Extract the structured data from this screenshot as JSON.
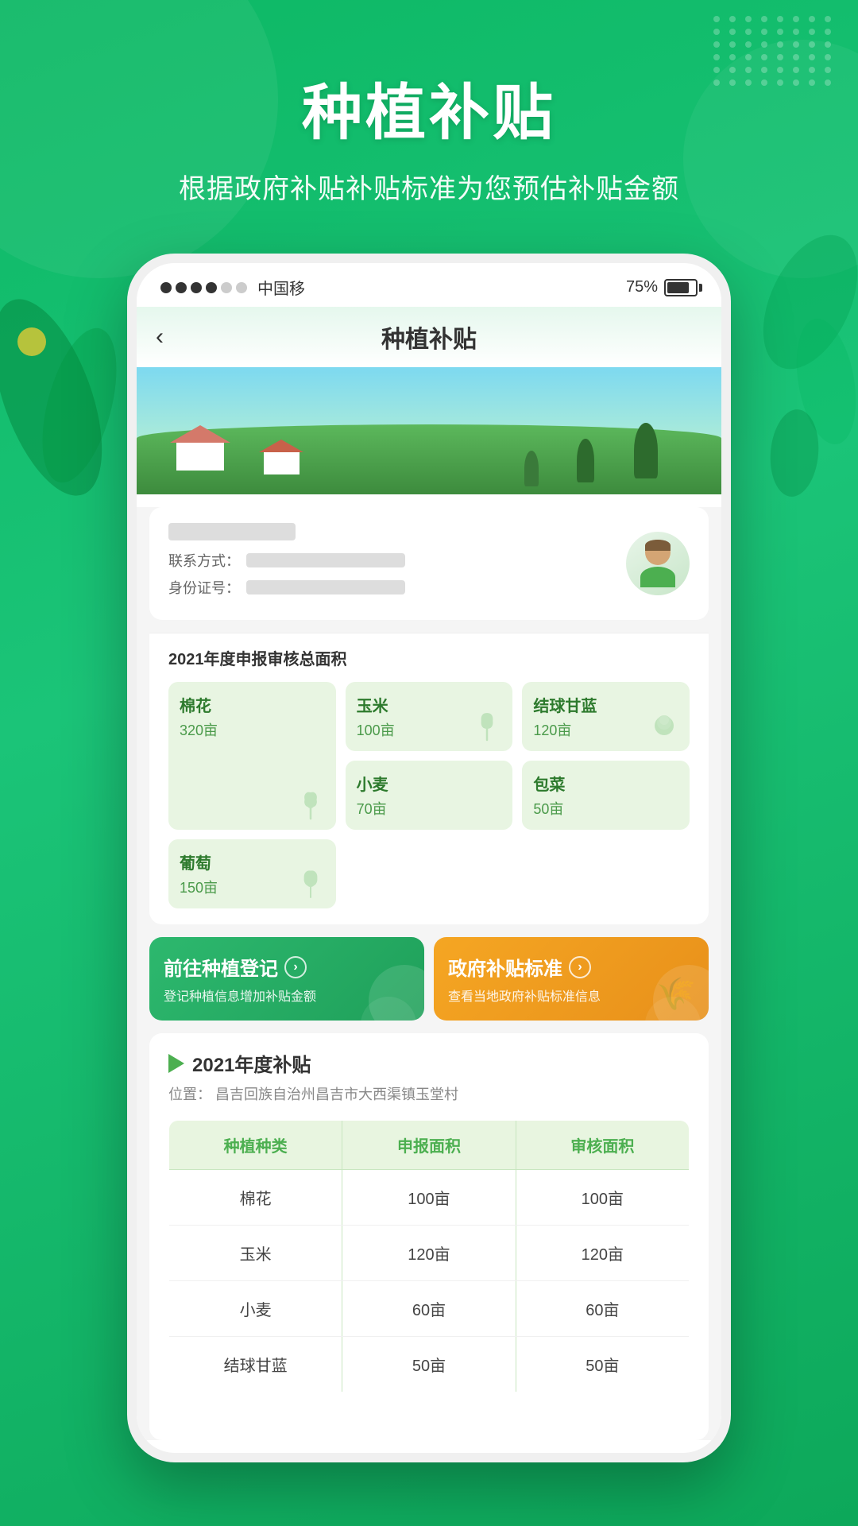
{
  "page": {
    "title": "种植补贴",
    "subtitle": "根据政府补贴补贴标准为您预估补贴金额"
  },
  "status_bar": {
    "carrier": "中国移",
    "battery_percent": "75%",
    "signals": [
      "filled",
      "filled",
      "filled",
      "filled",
      "empty",
      "empty"
    ]
  },
  "navbar": {
    "back_icon": "‹",
    "title": "种植补贴"
  },
  "user": {
    "contact_label": "联系方式：",
    "id_label": "身份证号："
  },
  "area_section": {
    "title": "2021年度申报审核总面积",
    "crops": [
      {
        "name": "棉花",
        "area": "320亩",
        "large": true
      },
      {
        "name": "玉米",
        "area": "100亩",
        "large": false
      },
      {
        "name": "结球甘蓝",
        "area": "120亩",
        "large": false
      },
      {
        "name": "小麦",
        "area": "70亩",
        "large": false
      },
      {
        "name": "包菜",
        "area": "50亩",
        "large": false
      },
      {
        "name": "葡萄",
        "area": "150亩",
        "large": false
      }
    ]
  },
  "action_buttons": [
    {
      "title": "前往种植登记",
      "description": "登记种植信息增加补贴金额",
      "style": "green"
    },
    {
      "title": "政府补贴标准",
      "description": "查看当地政府补贴标准信息",
      "style": "orange"
    }
  ],
  "subsidy_section": {
    "year_title": "2021年度补贴",
    "location_label": "位置：",
    "location": "昌吉回族自治州昌吉市大西渠镇玉堂村",
    "table": {
      "headers": [
        "种植种类",
        "申报面积",
        "审核面积"
      ],
      "rows": [
        {
          "crop": "棉花",
          "declared": "100亩",
          "reviewed": "100亩"
        },
        {
          "crop": "玉米",
          "declared": "120亩",
          "reviewed": "120亩"
        },
        {
          "crop": "小麦",
          "declared": "60亩",
          "reviewed": "60亩"
        },
        {
          "crop": "结球甘蓝",
          "declared": "50亩",
          "reviewed": "50亩"
        }
      ]
    }
  },
  "colors": {
    "primary_green": "#1db96a",
    "light_green_bg": "#e8f5e2",
    "orange": "#f5a623",
    "text_dark": "#333333",
    "text_gray": "#888888"
  }
}
